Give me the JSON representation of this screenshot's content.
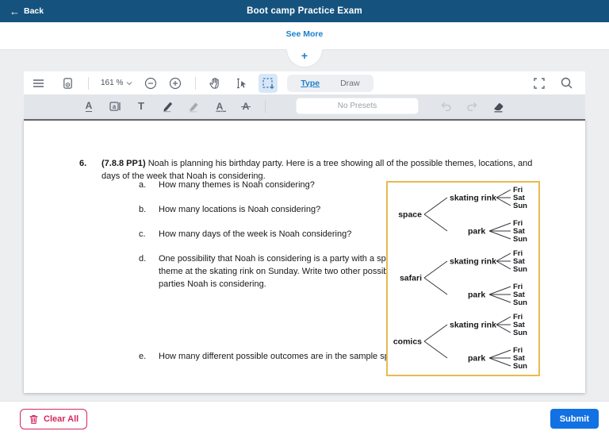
{
  "header": {
    "back_label": "Back",
    "title": "Boot camp Practice Exam"
  },
  "expander": {
    "see_more_label": "See More",
    "plus_glyph": "+"
  },
  "toolbar": {
    "zoom_level": "161 %",
    "tabs": {
      "type": "Type",
      "draw": "Draw"
    },
    "preset_placeholder": "No Presets",
    "text_tool_glyph": "T",
    "letter_glyph": "A",
    "note_glyph": "a"
  },
  "document": {
    "question_number": "6.",
    "question_tag": "(7.8.8 PP1)",
    "question_text": "Noah is planning his birthday party. Here is a tree showing all of the possible themes, locations, and days of the week that Noah is considering.",
    "sub_questions": [
      {
        "letter": "a.",
        "text": "How many themes is Noah considering?"
      },
      {
        "letter": "b.",
        "text": "How many locations is Noah considering?"
      },
      {
        "letter": "c.",
        "text": "How many days of the week is Noah considering?"
      },
      {
        "letter": "d.",
        "text": "One possibility that Noah is considering is a party with a space theme at the skating rink on Sunday. Write two other possible parties Noah is considering."
      },
      {
        "letter": "e.",
        "text": "How many different possible outcomes are in the sample space?"
      }
    ],
    "tree": {
      "themes": [
        "space",
        "safari",
        "comics"
      ],
      "locations": [
        "skating rink",
        "park"
      ],
      "days": [
        "Fri",
        "Sat",
        "Sun"
      ]
    }
  },
  "footer": {
    "clear_all_label": "Clear All",
    "submit_label": "Submit"
  },
  "colors": {
    "header-bg": "#15537e",
    "link-blue": "#1b80cc",
    "submit-blue": "#1271e3",
    "clear-pink": "#d6275f",
    "tree-border": "#e9bb4f"
  },
  "icons": [
    "back-arrow-icon",
    "plus-icon",
    "menu-icon",
    "page-settings-icon",
    "chevron-down-icon",
    "zoom-out-icon",
    "zoom-in-icon",
    "hand-tool-icon",
    "text-select-icon",
    "marquee-select-icon",
    "fullscreen-icon",
    "search-icon",
    "underline-text-icon",
    "note-text-icon",
    "text-tool-icon",
    "pen-icon",
    "highlighter-icon",
    "squiggly-underline-icon",
    "strikethrough-icon",
    "undo-icon",
    "redo-icon",
    "eraser-icon",
    "trash-icon"
  ]
}
